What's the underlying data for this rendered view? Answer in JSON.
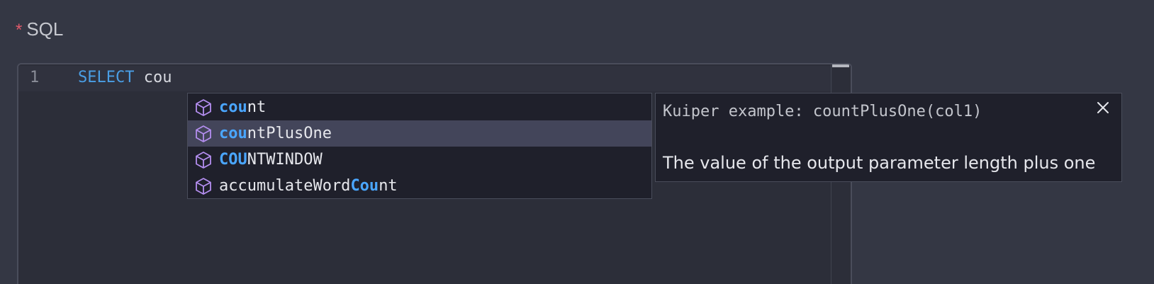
{
  "field": {
    "required_marker": "*",
    "label": "SQL"
  },
  "editor": {
    "line_number": "1",
    "keyword": "SELECT",
    "typed_text": "cou"
  },
  "suggestions": [
    {
      "match": "cou",
      "rest": "nt",
      "prefix": "",
      "icon": "cube-icon",
      "selected": false
    },
    {
      "match": "cou",
      "rest": "ntPlusOne",
      "prefix": "",
      "icon": "cube-icon",
      "selected": true
    },
    {
      "match": "COU",
      "rest": "NTWINDOW",
      "prefix": "",
      "icon": "cube-icon",
      "selected": false
    },
    {
      "match": "Cou",
      "rest": "nt",
      "prefix": "accumulateWord",
      "icon": "cube-icon",
      "selected": false
    }
  ],
  "details": {
    "signature": "Kuiper example: countPlusOne(col1)",
    "description": "The value of the output parameter length plus one",
    "close_icon": "close-icon"
  },
  "colors": {
    "background": "#343744",
    "keyword": "#4a9fe6",
    "match_highlight": "#4aa6ff",
    "icon": "#b48ef0",
    "required": "#e05a6b"
  }
}
